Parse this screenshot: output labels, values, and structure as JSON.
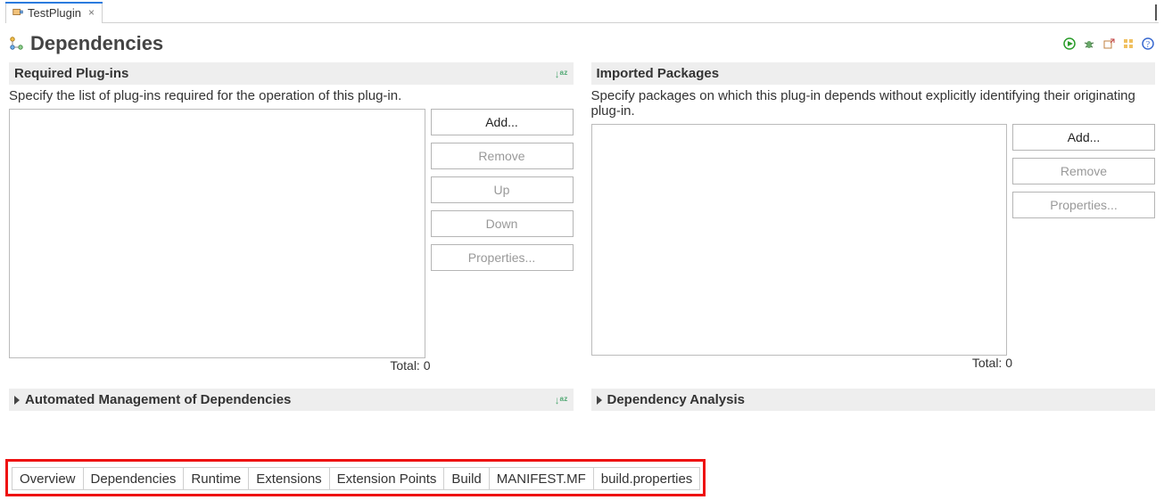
{
  "tab": {
    "title": "TestPlugin",
    "close": "×"
  },
  "page": {
    "title": "Dependencies"
  },
  "required": {
    "header": "Required Plug-ins",
    "description": "Specify the list of plug-ins required for the operation of this plug-in.",
    "buttons": {
      "add": "Add...",
      "remove": "Remove",
      "up": "Up",
      "down": "Down",
      "properties": "Properties..."
    },
    "total_label": "Total: 0"
  },
  "imported": {
    "header": "Imported Packages",
    "description": "Specify packages on which this plug-in depends without explicitly identifying their originating plug-in.",
    "buttons": {
      "add": "Add...",
      "remove": "Remove",
      "properties": "Properties..."
    },
    "total_label": "Total: 0"
  },
  "automated": {
    "header": "Automated Management of Dependencies"
  },
  "analysis": {
    "header": "Dependency Analysis"
  },
  "bottom_tabs": [
    "Overview",
    "Dependencies",
    "Runtime",
    "Extensions",
    "Extension Points",
    "Build",
    "MANIFEST.MF",
    "build.properties"
  ]
}
